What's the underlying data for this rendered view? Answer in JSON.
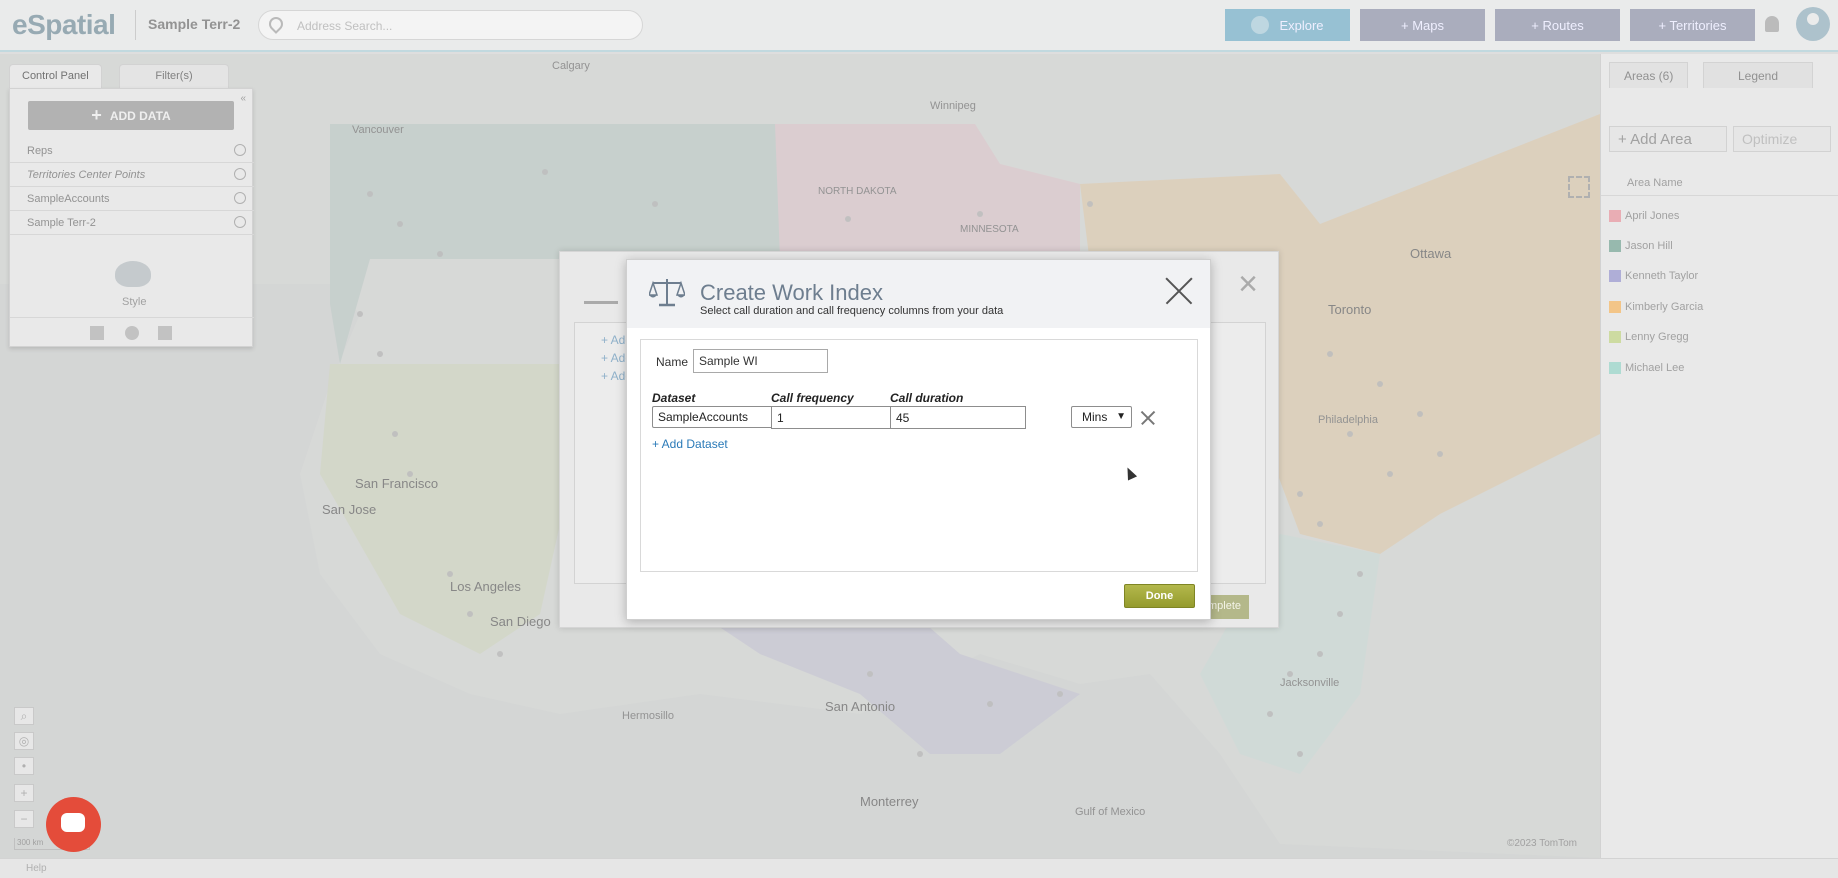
{
  "app": {
    "logo": "eSpatial",
    "map_title": "Sample Terr-2",
    "search_placeholder": "Address Search...",
    "nav": {
      "explore": "Explore",
      "maps": "+ Maps",
      "routes": "+ Routes",
      "territories": "+ Territories"
    }
  },
  "control_panel": {
    "tabs": [
      "Control Panel",
      "Filter(s)"
    ],
    "add_data": "ADD DATA",
    "layers": [
      "Reps",
      "Territories Center Points",
      "SampleAccounts",
      "Sample Terr-2"
    ],
    "style_label": "Style"
  },
  "right_panel": {
    "tabs": [
      "Areas (6)",
      "Legend"
    ],
    "add_area": "Add Area",
    "optimize": "Optimize",
    "column_header": "Area Name",
    "areas": [
      {
        "name": "April Jones",
        "color": "#e8a6ae"
      },
      {
        "name": "Jason Hill",
        "color": "#8fb3a8"
      },
      {
        "name": "Kenneth Taylor",
        "color": "#a9a8d4"
      },
      {
        "name": "Kimberly Garcia",
        "color": "#f2c07e"
      },
      {
        "name": "Lenny Gregg",
        "color": "#c9d89a"
      },
      {
        "name": "Michael Lee",
        "color": "#a8d8cf"
      }
    ]
  },
  "map": {
    "labels": [
      "Calgary",
      "Vancouver",
      "Winnipeg",
      "NORTH DAKOTA",
      "MINNESOTA",
      "Ottawa",
      "Toronto",
      "San Jose",
      "San Francisco",
      "Los Angeles",
      "San Diego",
      "Hermosillo",
      "San Antonio",
      "Monterrey",
      "Jacksonville",
      "Gulf of Mexico",
      "Philadelphia"
    ],
    "copyright": "©2023 TomTom",
    "scale": "300 km"
  },
  "background_dialog": {
    "links": [
      "+ Add",
      "+ Add",
      "+ Add"
    ],
    "complete": "Complete"
  },
  "dialog": {
    "title": "Create Work Index",
    "subtitle": "Select call duration and call frequency columns from your data",
    "name_label": "Name",
    "name_value": "Sample WI",
    "columns": {
      "dataset": "Dataset",
      "call_frequency": "Call frequency",
      "call_duration": "Call duration"
    },
    "row": {
      "dataset": "SampleAccounts",
      "call_frequency": "1",
      "call_duration": "45",
      "unit": "Mins"
    },
    "add_dataset": "+ Add Dataset",
    "done": "Done"
  },
  "footer": {
    "help": "Help"
  }
}
